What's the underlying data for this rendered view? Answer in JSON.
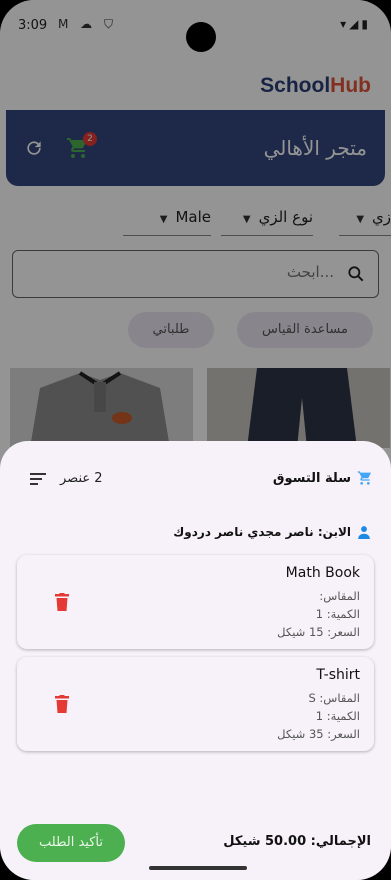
{
  "status": {
    "time": "3:09",
    "left_icons": "M ☁ ⛉",
    "right_icons": "▾◢▮"
  },
  "brand": {
    "part1": "School",
    "part2": "Hub"
  },
  "appbar": {
    "title": "متجر الأهالي",
    "cart_badge": "2"
  },
  "filters": [
    {
      "label": "زي"
    },
    {
      "label": "نوع الزي"
    },
    {
      "label": "Male"
    }
  ],
  "search": {
    "placeholder": "ابحث..."
  },
  "chips": {
    "size_help": "مساعدة القياس",
    "my_orders": "طلباتي"
  },
  "sheet": {
    "title": "سلة التسوق",
    "item_count": "2 عنصر",
    "child_label": "الابن: ناصر مجدي ناصر دردوك",
    "items": [
      {
        "name": "Math Book",
        "size": "المقاس:",
        "qty": "الكمية: 1",
        "price": "السعر: 15 شيكل"
      },
      {
        "name": "T-shirt",
        "size": "المقاس: S",
        "qty": "الكمية: 1",
        "price": "السعر: 35 شيكل"
      }
    ],
    "total": "الإجمالي: 50.00 شيكل",
    "confirm": "تأكيد الطلب"
  },
  "colors": {
    "appbar": "#34487e",
    "accent": "#e0533b",
    "confirm": "#4caf50",
    "delete": "#e53935"
  }
}
